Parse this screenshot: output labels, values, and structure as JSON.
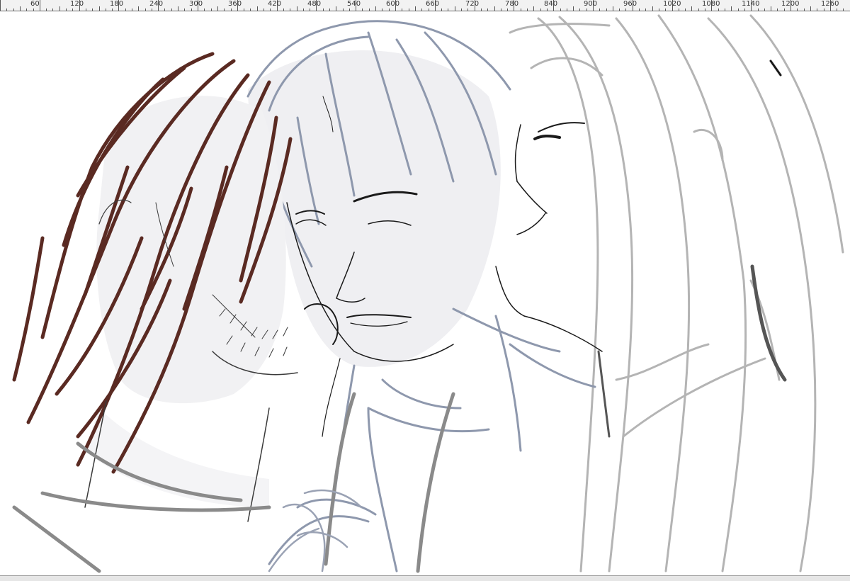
{
  "ruler": {
    "labels": [
      "60",
      "120",
      "180",
      "240",
      "300",
      "360",
      "420",
      "480",
      "540",
      "600",
      "660",
      "720",
      "780",
      "840",
      "900",
      "960",
      "1020",
      "1080",
      "1140",
      "1200",
      "1260"
    ]
  },
  "canvas": {
    "background": "#ffffff",
    "colors": {
      "hair_brown": "#5a2a22",
      "sketch_blue": "#8e98ad",
      "sketch_gray": "#b4b4b4",
      "sketch_dark": "#6e6e6e",
      "lineart": "#1a1a1a",
      "skin_shade": "#e9e9ec"
    }
  }
}
